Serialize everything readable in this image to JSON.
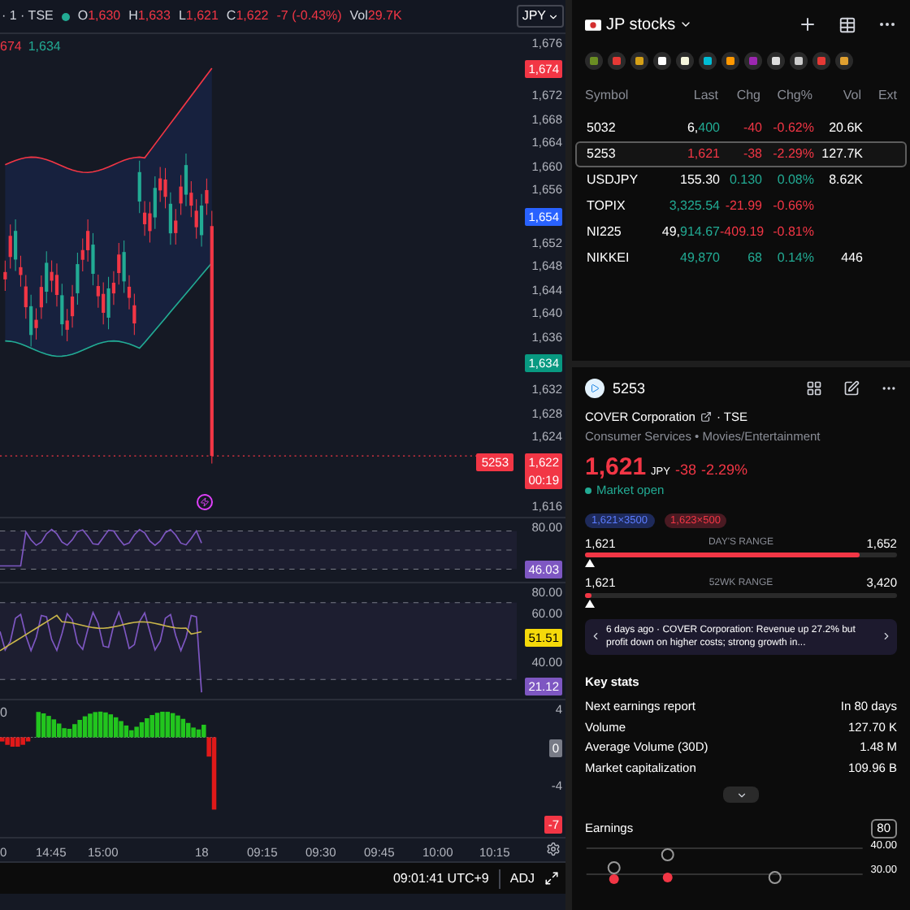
{
  "chart": {
    "legend": {
      "symbol": "· 1 · TSE",
      "ohlc": [
        {
          "label": "O",
          "value": "1,630"
        },
        {
          "label": "H",
          "value": "1,633"
        },
        {
          "label": "L",
          "value": "1,621"
        },
        {
          "label": "C",
          "value": "1,622"
        }
      ],
      "change": "-7 (-0.43%)",
      "color": "#f23645",
      "volume_label": "Vol",
      "volume": "29.7K"
    },
    "currency": "JPY",
    "panes": [
      {
        "kind": "price",
        "legend": [
          {
            "text": "674",
            "color": "#f23645"
          },
          {
            "text": "1,634",
            "color": "#22ab94"
          }
        ],
        "axis": [
          {
            "kind": "tick",
            "text": "1,676"
          },
          {
            "kind": "tag",
            "text": "1,674",
            "color": "#f23645"
          },
          {
            "kind": "tick",
            "text": "1,672"
          },
          {
            "kind": "tick",
            "text": "1,668"
          },
          {
            "kind": "tick",
            "text": "1,664"
          },
          {
            "kind": "tick",
            "text": "1,660"
          },
          {
            "kind": "tick",
            "text": "1,656"
          },
          {
            "kind": "tag",
            "text": "1,654",
            "color": "#2962ff"
          },
          {
            "kind": "tick",
            "text": "1,652"
          },
          {
            "kind": "tick",
            "text": "1,648"
          },
          {
            "kind": "tick",
            "text": "1,644"
          },
          {
            "kind": "tick",
            "text": "1,640"
          },
          {
            "kind": "tick",
            "text": "1,636"
          },
          {
            "kind": "tag",
            "text": "1,634",
            "color": "#089981"
          },
          {
            "kind": "tick",
            "text": "1,632"
          },
          {
            "kind": "tick",
            "text": "1,628"
          },
          {
            "kind": "tick",
            "text": "1,624"
          },
          {
            "kind": "tag",
            "text": "1,622",
            "countdown": "00:19",
            "symbol": "5253",
            "color": "#f23645"
          },
          {
            "kind": "tick",
            "text": "1,616"
          }
        ]
      },
      {
        "kind": "rsi",
        "axis": [
          {
            "kind": "tick",
            "text": "80.00"
          },
          {
            "kind": "tag",
            "text": "46.03",
            "color": "#7e57c2"
          }
        ]
      },
      {
        "kind": "stoch",
        "axis": [
          {
            "kind": "tick",
            "text": "80.00"
          },
          {
            "kind": "tick",
            "text": "60.00"
          },
          {
            "kind": "tag",
            "text": "51.51",
            "color": "#f5d90a"
          },
          {
            "kind": "tick",
            "text": "40.00"
          },
          {
            "kind": "tag",
            "text": "21.12",
            "color": "#7e57c2"
          }
        ]
      },
      {
        "kind": "histogram",
        "legend": [
          {
            "text": "0",
            "color": "#b2b5be"
          }
        ],
        "axis": [
          {
            "kind": "tick",
            "text": "4"
          },
          {
            "kind": "tag",
            "text": "0",
            "color": "#787b86"
          },
          {
            "kind": "tick",
            "text": "-4"
          },
          {
            "kind": "tag",
            "text": "-7",
            "color": "#f23645"
          }
        ]
      }
    ],
    "time_axis": [
      "0",
      "14:45",
      "15:00",
      "18",
      "09:15",
      "09:30",
      "09:45",
      "10:00",
      "10:15"
    ],
    "status_bar": {
      "time": "09:01:41 UTC+9",
      "adjustment": "ADJ"
    }
  },
  "watchlist": {
    "title": "JP stocks",
    "columns": [
      "Symbol",
      "Last",
      "Chg",
      "Chg%",
      "Vol",
      "Ext"
    ],
    "rows": [
      {
        "symbol": "5032",
        "last": {
          "head": "6,",
          "tail": "400",
          "color": "#22ab94"
        },
        "change": "-40",
        "change_percent": "-0.62%",
        "color": "#f23645",
        "volume": "20.6K",
        "selected": false
      },
      {
        "symbol": "5253",
        "last": {
          "tail": "1,621",
          "color": "#f23645"
        },
        "change": "-38",
        "change_percent": "-2.29%",
        "color": "#f23645",
        "volume": "127.7K",
        "selected": true
      },
      {
        "symbol": "USDJPY",
        "last": {
          "head": "155.30"
        },
        "change": "0.130",
        "change_percent": "0.08%",
        "color": "#22ab94",
        "volume": "8.62K",
        "selected": false
      },
      {
        "symbol": "TOPIX",
        "last": {
          "tail": "3,325.54",
          "color": "#22ab94"
        },
        "change": "-21.99",
        "change_percent": "-0.66%",
        "color": "#f23645",
        "selected": false
      },
      {
        "symbol": "NI225",
        "last": {
          "head": "49,",
          "tail": "914.67",
          "color": "#22ab94"
        },
        "change": "-409.19",
        "change_percent": "-0.81%",
        "color": "#f23645",
        "selected": false
      },
      {
        "symbol": "NIKKEI",
        "last": {
          "tail": "49,870",
          "color": "#22ab94"
        },
        "change": "68",
        "change_percent": "0.14%",
        "color": "#22ab94",
        "volume": "446",
        "selected": false
      }
    ]
  },
  "details": {
    "symbol": "5253",
    "name": "COVER Corporation",
    "exchange": "· TSE",
    "category": "Consumer Services • Movies/Entertainment",
    "price": "1,621",
    "currency": "JPY",
    "change": "-38",
    "change_percent": "-2.29%",
    "color": "#f23645",
    "status": "Market open",
    "quotes": [
      {
        "text": "1,621×3500",
        "kind": "bid"
      },
      {
        "text": "1,623×500",
        "kind": "ask"
      }
    ],
    "ranges": [
      {
        "low": "1,621",
        "label": "DAY'S RANGE",
        "high": "1,652",
        "level": 0.88
      },
      {
        "low": "1,621",
        "label": "52WK RANGE",
        "high": "3,420",
        "level": 0.02
      }
    ],
    "news": "6 days ago · COVER Corporation: Revenue up 27.2% but profit down on higher costs; strong growth in...",
    "key_stats": {
      "title": "Key stats",
      "rows": [
        {
          "label": "Next earnings report",
          "value": "In 80 days"
        },
        {
          "label": "Volume",
          "value": "127.70 K"
        },
        {
          "label": "Average Volume (30D)",
          "value": "1.48 M"
        },
        {
          "label": "Market capitalization",
          "value": "109.96 B"
        }
      ]
    },
    "earnings": {
      "title": "Earnings",
      "badge": "80",
      "ticks": [
        "40.00",
        "30.00"
      ]
    }
  }
}
